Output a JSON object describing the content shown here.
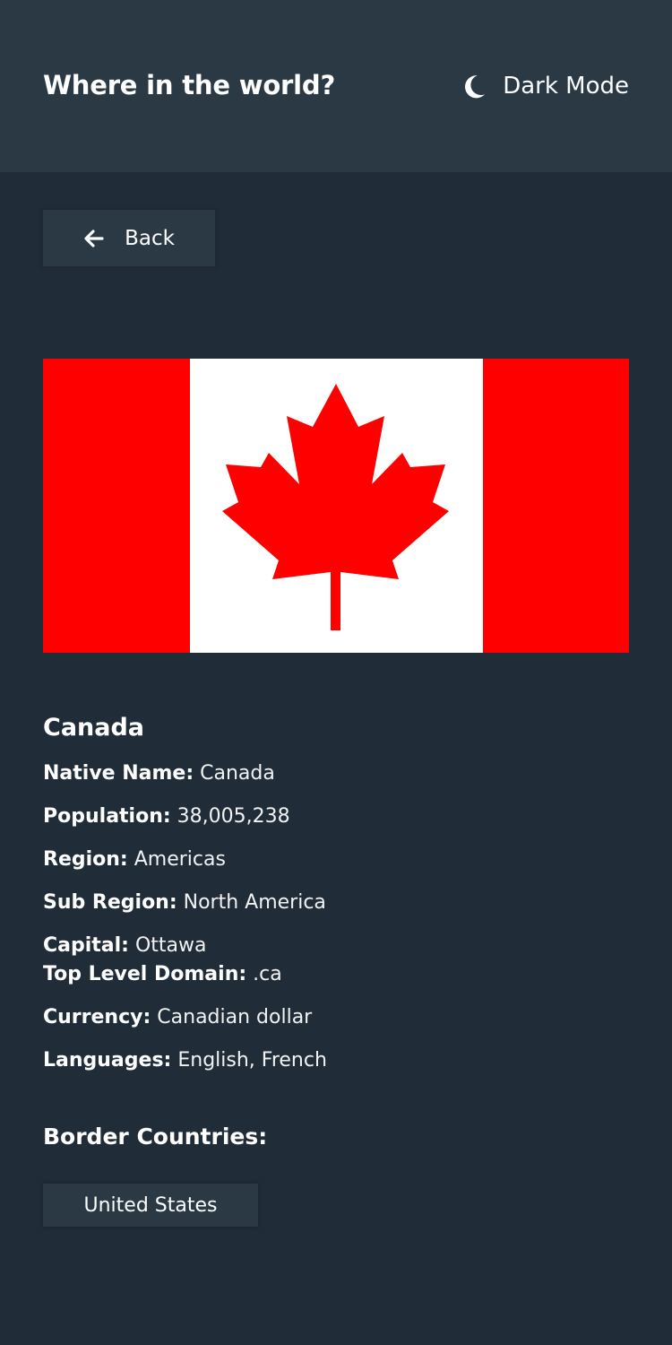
{
  "header": {
    "title": "Where in the world?",
    "mode_label": "Dark Mode",
    "mode_icon": "moon-icon"
  },
  "back_button": {
    "label": "Back",
    "icon": "arrow-left-icon"
  },
  "flag": {
    "icon": "canada-flag",
    "colors": {
      "red": "#ff0000",
      "white": "#ffffff"
    }
  },
  "country": {
    "name": "Canada",
    "details": [
      {
        "key": "Native Name:",
        "value": "Canada"
      },
      {
        "key": "Population:",
        "value": "38,005,238"
      },
      {
        "key": "Region:",
        "value": "Americas"
      },
      {
        "key": "Sub Region:",
        "value": "North America"
      },
      {
        "key": "Capital:",
        "value": "Ottawa"
      },
      {
        "key": "Top Level Domain:",
        "value": ".ca"
      },
      {
        "key": "Currency:",
        "value": "Canadian dollar"
      },
      {
        "key": "Languages:",
        "value": "English, French"
      }
    ]
  },
  "border": {
    "title": "Border Countries:",
    "countries": [
      "United States"
    ]
  },
  "colors": {
    "background": "#202c37",
    "elements": "#2b3945",
    "text": "#ffffff"
  }
}
